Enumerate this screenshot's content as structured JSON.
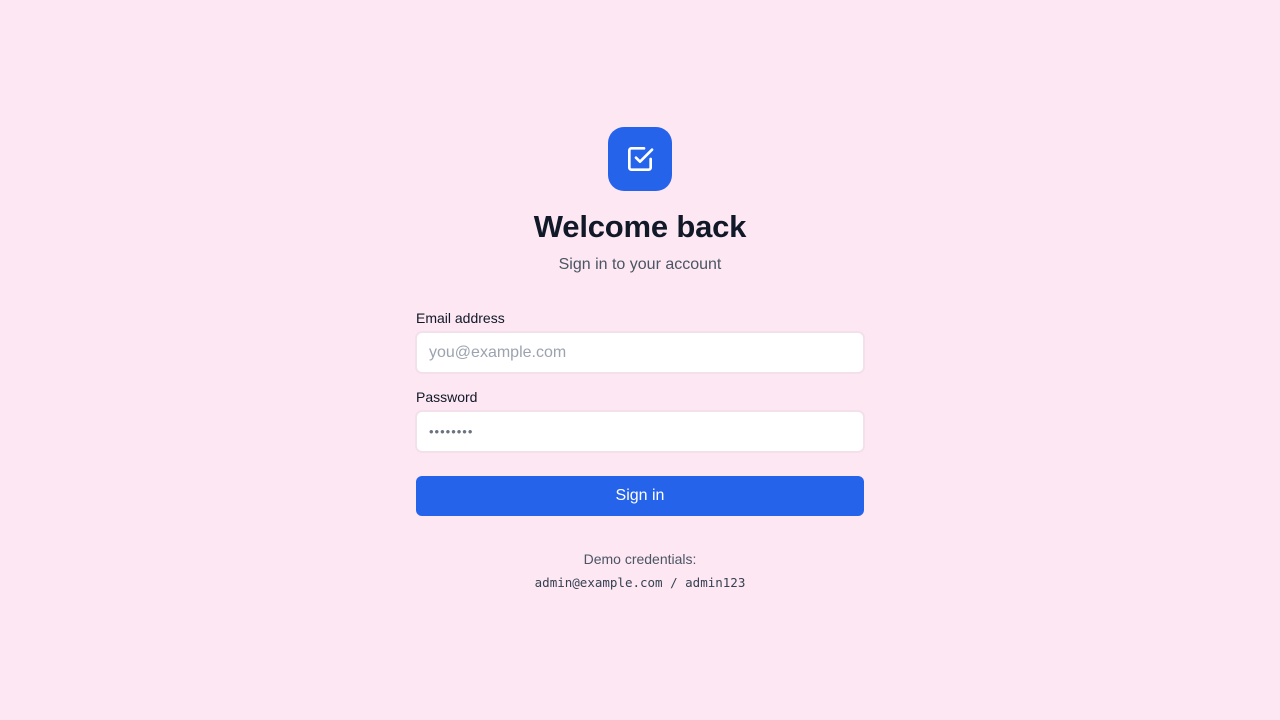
{
  "logo": {
    "icon": "checkbox-check-icon",
    "color": "#2563eb"
  },
  "header": {
    "title": "Welcome back",
    "subtitle": "Sign in to your account"
  },
  "form": {
    "email_label": "Email address",
    "email_placeholder": "you@example.com",
    "email_value": "",
    "password_label": "Password",
    "password_value": "••••••••",
    "submit_label": "Sign in"
  },
  "demo": {
    "label": "Demo credentials:",
    "credentials": "admin@example.com / admin123"
  },
  "colors": {
    "background": "#fce7f3",
    "accent": "#2563eb"
  }
}
